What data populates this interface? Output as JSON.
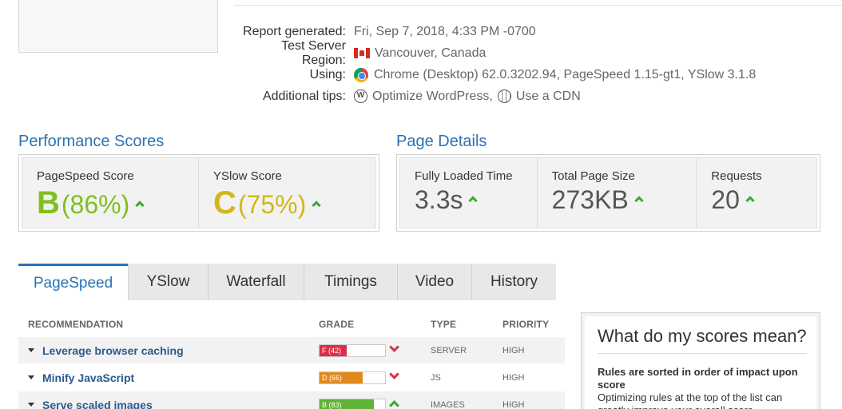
{
  "meta": {
    "report_label": "Report generated:",
    "report_value": "Fri, Sep 7, 2018, 4:33 PM -0700",
    "region_label": "Test Server Region:",
    "region_value": "Vancouver, Canada",
    "using_label": "Using:",
    "using_value": "Chrome (Desktop) 62.0.3202.94, PageSpeed 1.15-gt1, YSlow 3.1.8",
    "tips_label": "Additional tips:",
    "tip1": "Optimize WordPress,",
    "tip2": "Use a CDN"
  },
  "performance": {
    "title": "Performance Scores",
    "pagespeed_label": "PageSpeed Score",
    "pagespeed_grade": "B",
    "pagespeed_pct": "(86%)",
    "pagespeed_color": "#7fbf1f",
    "yslow_label": "YSlow Score",
    "yslow_grade": "C",
    "yslow_pct": "(75%)",
    "yslow_color": "#d4b61b"
  },
  "details": {
    "title": "Page Details",
    "load_label": "Fully Loaded Time",
    "load_value": "3.3s",
    "size_label": "Total Page Size",
    "size_value": "273KB",
    "req_label": "Requests",
    "req_value": "20"
  },
  "tabs": [
    "PageSpeed",
    "YSlow",
    "Waterfall",
    "Timings",
    "Video",
    "History"
  ],
  "table": {
    "headers": [
      "RECOMMENDATION",
      "GRADE",
      "TYPE",
      "PRIORITY"
    ],
    "rows": [
      {
        "name": "Leverage browser caching",
        "grade": "F (42)",
        "score": 42,
        "color": "#d9304a",
        "trend": "down",
        "type": "SERVER",
        "priority": "HIGH"
      },
      {
        "name": "Minify JavaScript",
        "grade": "D (66)",
        "score": 66,
        "color": "#e08a1e",
        "trend": "down",
        "type": "JS",
        "priority": "HIGH"
      },
      {
        "name": "Serve scaled images",
        "grade": "B (83)",
        "score": 83,
        "color": "#5fb336",
        "trend": "up",
        "type": "IMAGES",
        "priority": "HIGH"
      }
    ]
  },
  "sidebar": {
    "title": "What do my scores mean?",
    "bold": "Rules are sorted in order of impact upon score",
    "text": "Optimizing rules at the top of the list can greatly improve your overall score."
  }
}
